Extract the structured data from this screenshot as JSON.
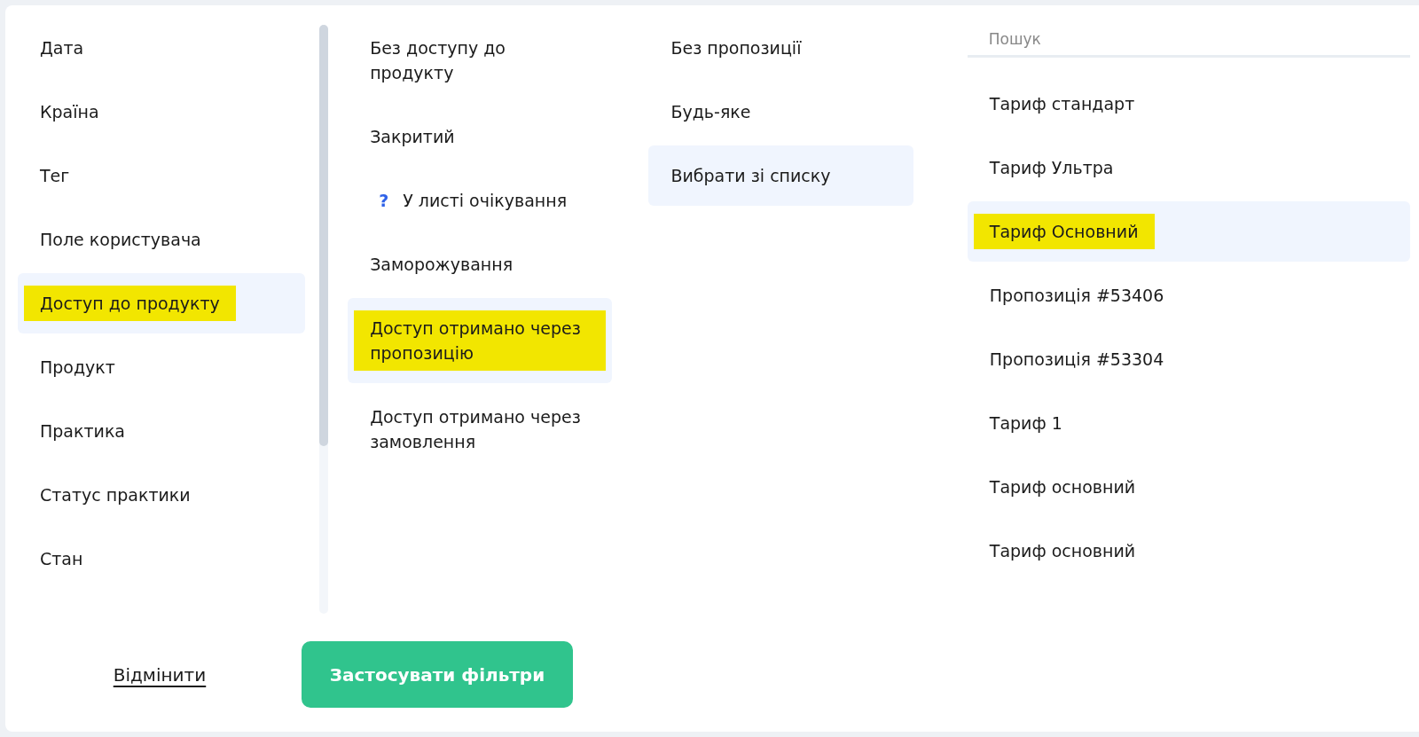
{
  "categories": [
    {
      "label": "Дата",
      "selected": false,
      "highlighted": false
    },
    {
      "label": "Країна",
      "selected": false,
      "highlighted": false
    },
    {
      "label": "Тег",
      "selected": false,
      "highlighted": false
    },
    {
      "label": "Поле користувача",
      "selected": false,
      "highlighted": false
    },
    {
      "label": "Доступ до продукту",
      "selected": true,
      "highlighted": true
    },
    {
      "label": "Продукт",
      "selected": false,
      "highlighted": false
    },
    {
      "label": "Практика",
      "selected": false,
      "highlighted": false
    },
    {
      "label": "Статус практики",
      "selected": false,
      "highlighted": false
    },
    {
      "label": "Стан",
      "selected": false,
      "highlighted": false
    }
  ],
  "access_options": [
    {
      "kind": "plain",
      "label": "Без доступу до продукту",
      "selected": false,
      "highlighted": false
    },
    {
      "kind": "plain",
      "label": "Закритий",
      "selected": false,
      "highlighted": false
    },
    {
      "kind": "hint",
      "hint": "?",
      "label": "У листі очікування",
      "selected": false,
      "highlighted": false
    },
    {
      "kind": "plain",
      "label": "Заморожування",
      "selected": false,
      "highlighted": false
    },
    {
      "kind": "plain",
      "label": "Доступ отримано через пропозицію",
      "selected": true,
      "highlighted": true
    },
    {
      "kind": "plain",
      "label": "Доступ отримано через замовлення",
      "selected": false,
      "highlighted": false
    }
  ],
  "offer_modes": [
    {
      "label": "Без пропозиції",
      "selected": false,
      "highlighted": false
    },
    {
      "label": "Будь-яке",
      "selected": false,
      "highlighted": false
    },
    {
      "label": "Вибрати зі списку",
      "selected": true,
      "highlighted": false
    }
  ],
  "search": {
    "placeholder": "Пошук"
  },
  "offers": [
    {
      "label": "Тариф стандарт",
      "selected": false,
      "highlighted": false
    },
    {
      "label": "Тариф Ультра",
      "selected": false,
      "highlighted": false
    },
    {
      "label": "Тариф Основний",
      "selected": true,
      "highlighted": true
    },
    {
      "label": "Пропозиція #53406",
      "selected": false,
      "highlighted": false
    },
    {
      "label": "Пропозиція #53304",
      "selected": false,
      "highlighted": false
    },
    {
      "label": "Тариф 1",
      "selected": false,
      "highlighted": false
    },
    {
      "label": "Тариф основний",
      "selected": false,
      "highlighted": false
    },
    {
      "label": "Тариф основний",
      "selected": false,
      "highlighted": false
    }
  ],
  "cancel_link": "Відмінити",
  "apply_button": "Застосувати фільтри"
}
